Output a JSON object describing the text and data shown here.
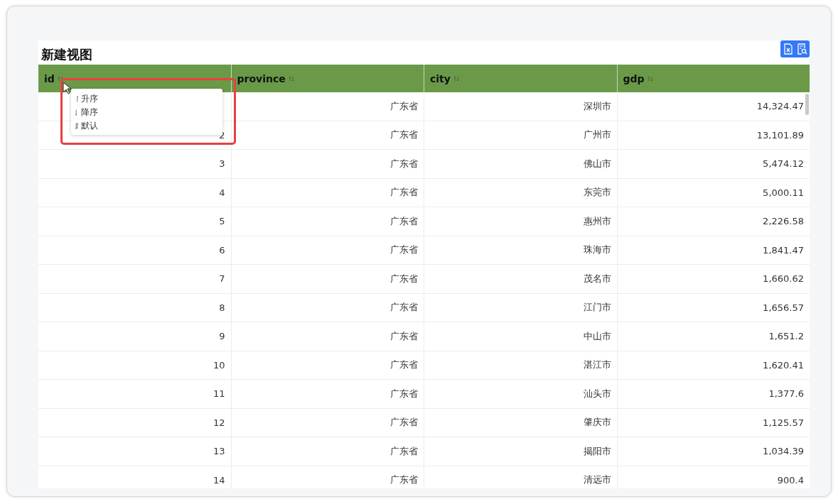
{
  "view": {
    "title": "新建视图"
  },
  "table": {
    "columns": [
      "id",
      "province",
      "city",
      "gdp"
    ],
    "rows": [
      {
        "province": "广东省",
        "city": "深圳市",
        "gdp": "14,324.47"
      },
      {
        "id": "2",
        "province": "广东省",
        "city": "广州市",
        "gdp": "13,101.89"
      },
      {
        "id": "3",
        "province": "广东省",
        "city": "佛山市",
        "gdp": "5,474.12"
      },
      {
        "id": "4",
        "province": "广东省",
        "city": "东莞市",
        "gdp": "5,000.11"
      },
      {
        "id": "5",
        "province": "广东省",
        "city": "惠州市",
        "gdp": "2,226.58"
      },
      {
        "id": "6",
        "province": "广东省",
        "city": "珠海市",
        "gdp": "1,841.47"
      },
      {
        "id": "7",
        "province": "广东省",
        "city": "茂名市",
        "gdp": "1,660.62"
      },
      {
        "id": "8",
        "province": "广东省",
        "city": "江门市",
        "gdp": "1,656.57"
      },
      {
        "id": "9",
        "province": "广东省",
        "city": "中山市",
        "gdp": "1,651.2"
      },
      {
        "id": "10",
        "province": "广东省",
        "city": "湛江市",
        "gdp": "1,620.41"
      },
      {
        "id": "11",
        "province": "广东省",
        "city": "汕头市",
        "gdp": "1,377.6"
      },
      {
        "id": "12",
        "province": "广东省",
        "city": "肇庆市",
        "gdp": "1,125.57"
      },
      {
        "id": "13",
        "province": "广东省",
        "city": "揭阳市",
        "gdp": "1,034.39"
      },
      {
        "id": "14",
        "province": "广东省",
        "city": "清远市",
        "gdp": "900.4"
      }
    ]
  },
  "sort_menu": {
    "items": [
      {
        "kind": "asc",
        "label": "升序"
      },
      {
        "kind": "desc",
        "label": "降序"
      },
      {
        "kind": "default",
        "label": "默认"
      }
    ]
  }
}
